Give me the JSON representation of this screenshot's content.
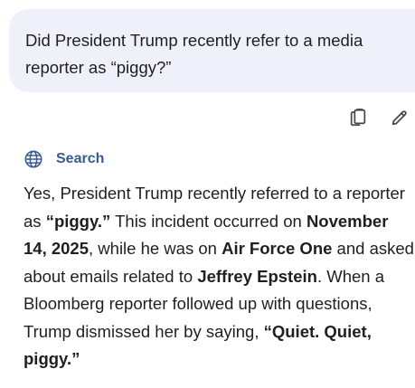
{
  "user_message": {
    "text": "Did President Trump recently refer to a media reporter as “piggy?”"
  },
  "actions": {
    "copy_icon": "copy-icon",
    "edit_icon": "edit-pencil-icon"
  },
  "source": {
    "icon": "globe-icon",
    "label": "Search",
    "label_color": "#3b5a94"
  },
  "response": {
    "segments": [
      {
        "text": "Yes, President Trump recently referred to a reporter as ",
        "bold": false
      },
      {
        "text": "“piggy.”",
        "bold": true
      },
      {
        "text": " This incident occurred on ",
        "bold": false
      },
      {
        "text": "November 14, 2025",
        "bold": true
      },
      {
        "text": ", while he was on ",
        "bold": false
      },
      {
        "text": "Air Force One",
        "bold": true
      },
      {
        "text": " and asked about emails related to ",
        "bold": false
      },
      {
        "text": "Jeffrey Epstein",
        "bold": true
      },
      {
        "text": ". When a Bloomberg reporter followed up with questions, Trump dismissed her by saying, ",
        "bold": false
      },
      {
        "text": "“Quiet. Quiet, piggy.”",
        "bold": true
      }
    ]
  },
  "colors": {
    "bubble_background": "#eef1f9",
    "text": "#1f1f1f",
    "icon": "#444746"
  }
}
